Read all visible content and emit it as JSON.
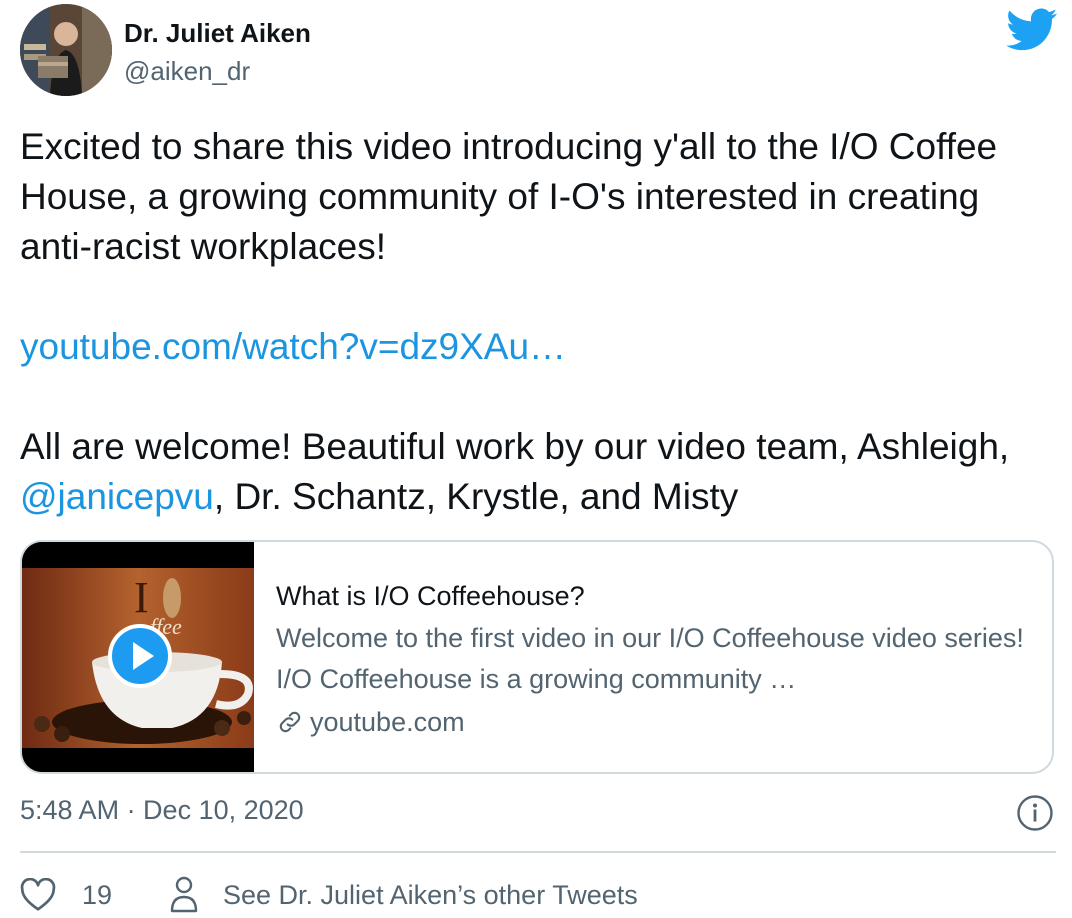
{
  "author": {
    "display_name": "Dr. Juliet Aiken",
    "handle": "@aiken_dr"
  },
  "brand": {
    "icon": "twitter-bird-icon",
    "color": "#1da1f2"
  },
  "tweet": {
    "paragraph1": "Excited to share this video introducing y'all to the I/O Coffee House, a growing community of I-O's interested in creating anti-racist workplaces!",
    "link_text": "youtube.com/watch?v=dz9XAu…",
    "paragraph3_text": "All are welcome! Beautiful work by our video team, Ashleigh,",
    "mention": "@janicepvu",
    "paragraph3_rest": ", Dr. Schantz, Krystle, and Misty"
  },
  "card": {
    "title": "What is I/O Coffeehouse?",
    "description": "Welcome to the first video in our I/O Coffeehouse video series! I/O Coffeehouse is a growing community …",
    "domain": "youtube.com",
    "thumbnail_text": "I",
    "thumbnail_subtext": "ffee",
    "play_icon": "play-icon",
    "link_icon": "link-icon"
  },
  "footer": {
    "timestamp": "5:48 AM · Dec 10, 2020",
    "like_count": "19",
    "other_tweets_label": "See Dr. Juliet Aiken’s other Tweets"
  },
  "colors": {
    "link": "#1b95e0",
    "secondary_text": "#536471",
    "border": "#cfd9de"
  }
}
